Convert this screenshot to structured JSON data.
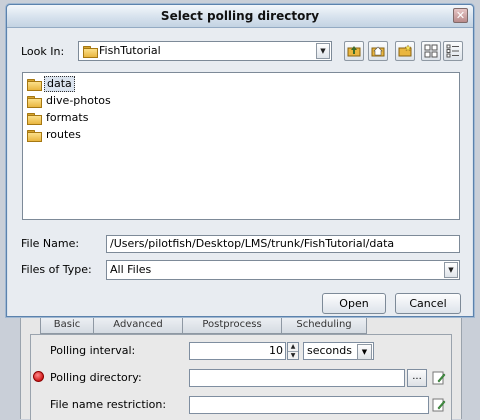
{
  "dialog": {
    "title": "Select polling directory",
    "close_glyph": "✕",
    "look_in_label": "Look In:",
    "look_in_value": "FishTutorial",
    "toolbar_icons": [
      "up-folder-icon",
      "home-icon",
      "new-folder-icon",
      "list-view-icon",
      "details-view-icon"
    ],
    "files": [
      {
        "name": "data",
        "selected": true
      },
      {
        "name": "dive-photos",
        "selected": false
      },
      {
        "name": "formats",
        "selected": false
      },
      {
        "name": "routes",
        "selected": false
      }
    ],
    "file_name_label": "File Name:",
    "file_name_value": "/Users/pilotfish/Desktop/LMS/trunk/FishTutorial/data",
    "file_type_label": "Files of Type:",
    "file_type_value": "All Files",
    "open_label": "Open",
    "cancel_label": "Cancel"
  },
  "background": {
    "tabs": [
      "Basic",
      "Advanced",
      "Postprocess",
      "Scheduling"
    ],
    "polling_interval_label": "Polling interval:",
    "polling_interval_value": "10",
    "interval_unit": "seconds",
    "polling_directory_label": "Polling directory:",
    "browse_label": "...",
    "file_name_restriction_label": "File name restriction:"
  },
  "colors": {
    "accent": "#5b82ad",
    "error": "#d21a1a",
    "folder": "#e9b640"
  }
}
